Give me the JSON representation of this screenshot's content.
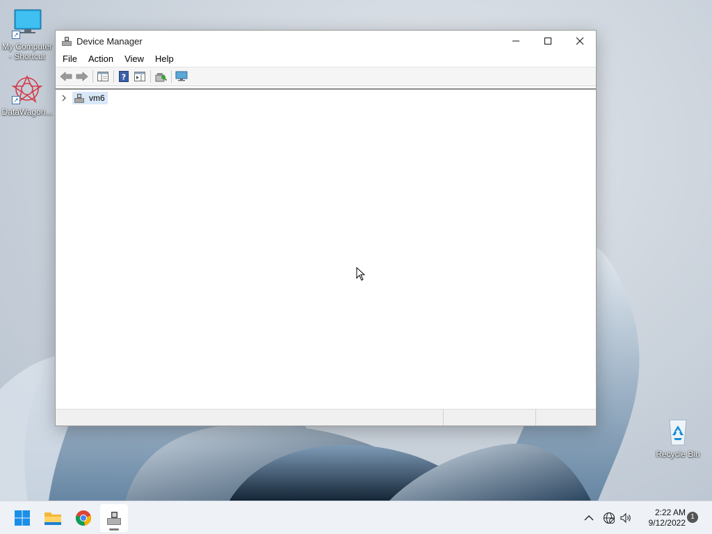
{
  "desktop": {
    "icons": [
      {
        "label": "My Computer - Shortcut",
        "icon": "monitor-icon"
      },
      {
        "label": "DataWagon...",
        "icon": "datawagon-logo-icon"
      },
      {
        "label": "Recycle Bin",
        "icon": "recycle-bin-icon"
      }
    ]
  },
  "window": {
    "title": "Device Manager",
    "menu": [
      "File",
      "Action",
      "View",
      "Help"
    ],
    "toolbar": [
      {
        "icon": "back-arrow-icon"
      },
      {
        "icon": "forward-arrow-icon"
      },
      {
        "icon": "show-hide-console-tree-icon"
      },
      {
        "icon": "help-icon"
      },
      {
        "icon": "properties-icon"
      },
      {
        "icon": "scan-hardware-changes-icon"
      },
      {
        "icon": "monitor-devices-icon"
      }
    ],
    "tree": {
      "root_label": "vm6",
      "expanded": false
    }
  },
  "taskbar": {
    "apps": [
      {
        "icon": "windows-start-icon"
      },
      {
        "icon": "file-explorer-icon"
      },
      {
        "icon": "chrome-icon"
      },
      {
        "icon": "device-manager-icon",
        "active": true
      }
    ],
    "tray": {
      "time": "2:22 AM",
      "date": "9/12/2022",
      "notifications": "1"
    }
  },
  "colors": {
    "accent": "#0078d4",
    "selection": "#d9e8f8"
  }
}
